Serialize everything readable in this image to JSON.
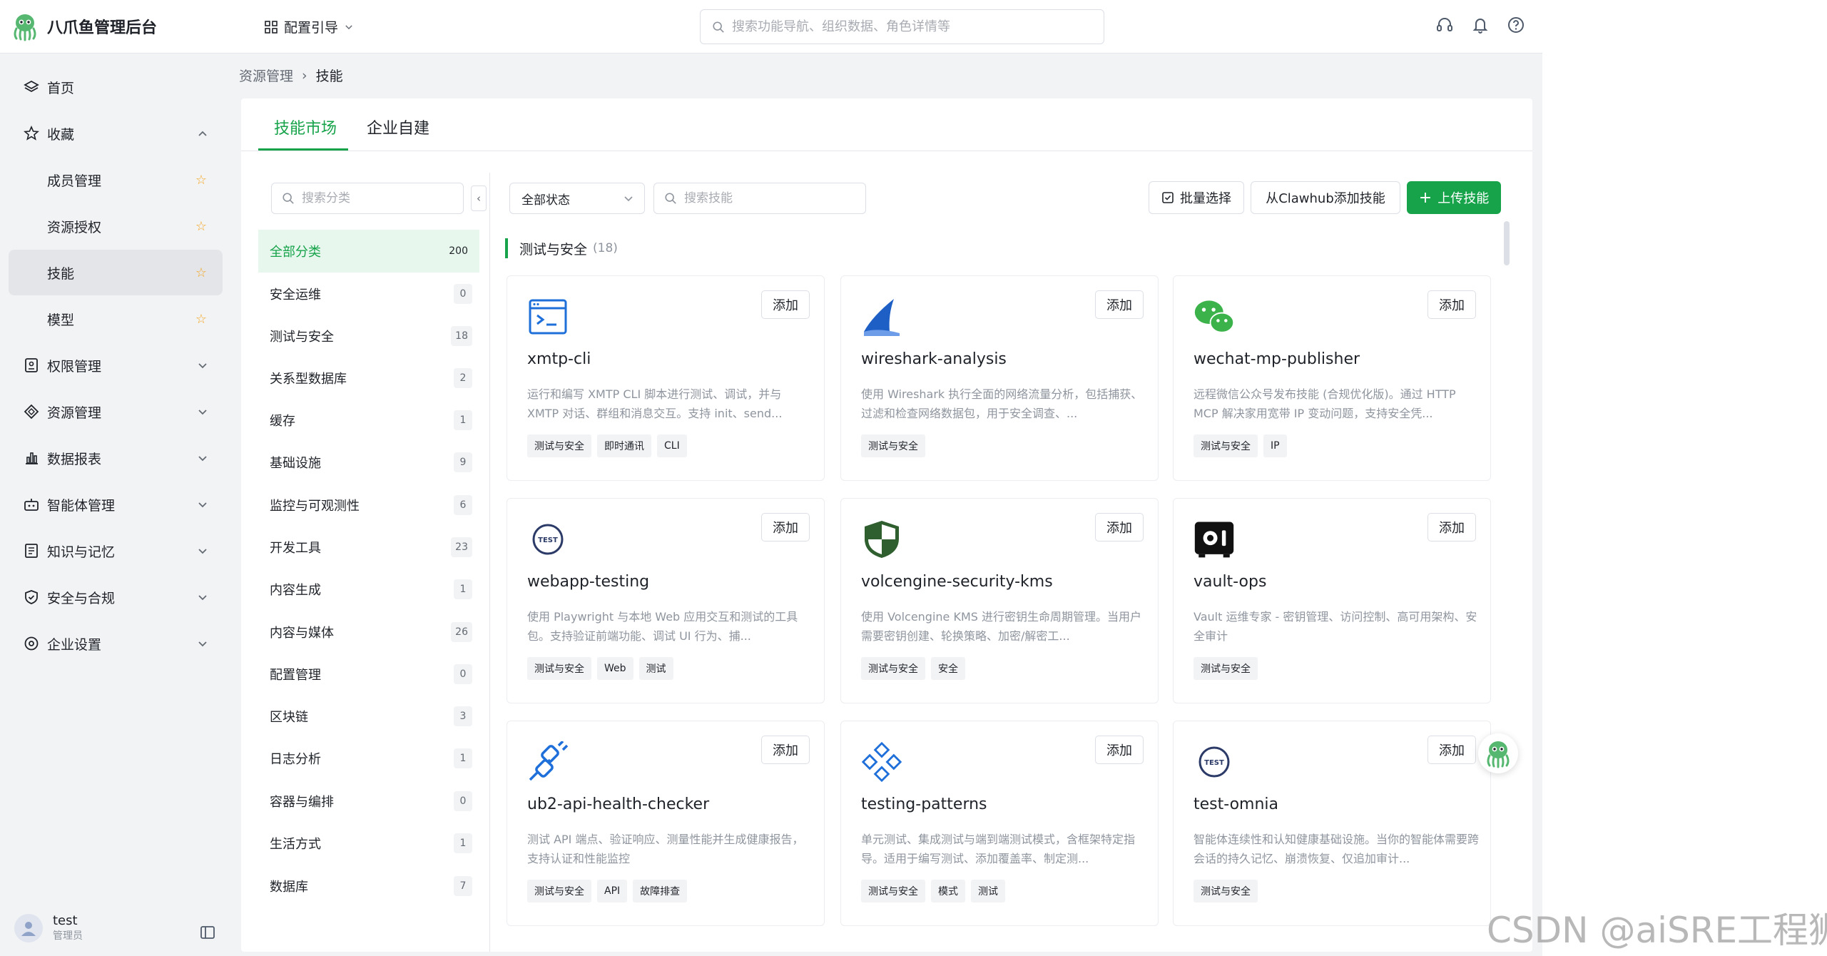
{
  "header": {
    "brand": "八爪鱼管理后台",
    "guide": "配置引导",
    "search_placeholder": "搜索功能导航、组织数据、角色详情等"
  },
  "sidebar": {
    "items": [
      {
        "label": "首页",
        "icon": "layers-icon"
      },
      {
        "label": "收藏",
        "icon": "star-outline-icon"
      },
      {
        "label": "成员管理"
      },
      {
        "label": "资源授权"
      },
      {
        "label": "技能"
      },
      {
        "label": "模型"
      },
      {
        "label": "权限管理",
        "icon": "id-card-icon"
      },
      {
        "label": "资源管理",
        "icon": "diamond-icon"
      },
      {
        "label": "数据报表",
        "icon": "bar-chart-icon"
      },
      {
        "label": "智能体管理",
        "icon": "robot-icon"
      },
      {
        "label": "知识与记忆",
        "icon": "book-icon"
      },
      {
        "label": "安全与合规",
        "icon": "shield-check-icon"
      },
      {
        "label": "企业设置",
        "icon": "settings-icon"
      }
    ],
    "user": {
      "name": "test",
      "role": "管理员"
    }
  },
  "breadcrumb": {
    "parent": "资源管理",
    "current": "技能"
  },
  "tabs": [
    "技能市场",
    "企业自建"
  ],
  "categories": {
    "search_placeholder": "搜索分类",
    "items": [
      {
        "label": "全部分类",
        "count": "200"
      },
      {
        "label": "安全运维",
        "count": "0"
      },
      {
        "label": "测试与安全",
        "count": "18"
      },
      {
        "label": "关系型数据库",
        "count": "2"
      },
      {
        "label": "缓存",
        "count": "1"
      },
      {
        "label": "基础设施",
        "count": "9"
      },
      {
        "label": "监控与可观测性",
        "count": "6"
      },
      {
        "label": "开发工具",
        "count": "23"
      },
      {
        "label": "内容生成",
        "count": "1"
      },
      {
        "label": "内容与媒体",
        "count": "26"
      },
      {
        "label": "配置管理",
        "count": "0"
      },
      {
        "label": "区块链",
        "count": "3"
      },
      {
        "label": "日志分析",
        "count": "1"
      },
      {
        "label": "容器与编排",
        "count": "0"
      },
      {
        "label": "生活方式",
        "count": "1"
      },
      {
        "label": "数据库",
        "count": "7"
      }
    ]
  },
  "toolbar": {
    "status": "全部状态",
    "search_placeholder": "搜索技能",
    "batch": "批量选择",
    "clawhub": "从Clawhub添加技能",
    "upload": "上传技能"
  },
  "section": {
    "title": "测试与安全",
    "count": "(18)"
  },
  "add_label": "添加",
  "skills": [
    {
      "name": "xmtp-cli",
      "icon": "terminal-icon",
      "desc": "运行和编写 XMTP CLI 脚本进行测试、调试，并与 XMTP 对话、群组和消息交互。支持 init、send...",
      "tags": [
        "测试与安全",
        "即时通讯",
        "CLI"
      ]
    },
    {
      "name": "wireshark-analysis",
      "icon": "shark-fin-icon",
      "desc": "使用 Wireshark 执行全面的网络流量分析，包括捕获、过滤和检查网络数据包，用于安全调查、...",
      "tags": [
        "测试与安全"
      ]
    },
    {
      "name": "wechat-mp-publisher",
      "icon": "wechat-icon",
      "desc": "远程微信公众号发布技能 (合规优化版)。通过 HTTP MCP 解决家用宽带 IP 变动问题，支持安全凭...",
      "tags": [
        "测试与安全",
        "IP"
      ]
    },
    {
      "name": "webapp-testing",
      "icon": "test-badge-icon",
      "desc": "使用 Playwright 与本地 Web 应用交互和测试的工具包。支持验证前端功能、调试 UI 行为、捕...",
      "tags": [
        "测试与安全",
        "Web",
        "测试"
      ]
    },
    {
      "name": "volcengine-security-kms",
      "icon": "shield-icon",
      "desc": "使用 Volcengine KMS 进行密钥生命周期管理。当用户需要密钥创建、轮换策略、加密/解密工...",
      "tags": [
        "测试与安全",
        "安全"
      ]
    },
    {
      "name": "vault-ops",
      "icon": "vault-icon",
      "desc": "Vault 运维专家 - 密钥管理、访问控制、高可用架构、安全审计",
      "tags": [
        "测试与安全"
      ]
    },
    {
      "name": "ub2-api-health-checker",
      "icon": "plug-icon",
      "desc": "测试 API 端点、验证响应、测量性能并生成健康报告，支持认证和性能监控",
      "tags": [
        "测试与安全",
        "API",
        "故障排查"
      ]
    },
    {
      "name": "testing-patterns",
      "icon": "diamonds-icon",
      "desc": "单元测试、集成测试与端到端测试模式，含框架特定指导。适用于编写测试、添加覆盖率、制定测...",
      "tags": [
        "测试与安全",
        "模式",
        "测试"
      ]
    },
    {
      "name": "test-omnia",
      "icon": "test-badge-icon",
      "desc": "智能体连续性和认知健康基础设施。当你的智能体需要跨会话的持久记忆、崩溃恢复、仅追加审计...",
      "tags": [
        "测试与安全"
      ]
    }
  ],
  "watermark": "CSDN @aiSRE工程狮",
  "colors": {
    "accent": "#16a34a",
    "accent_bg": "#e7f7ed",
    "star": "#f5a623"
  }
}
